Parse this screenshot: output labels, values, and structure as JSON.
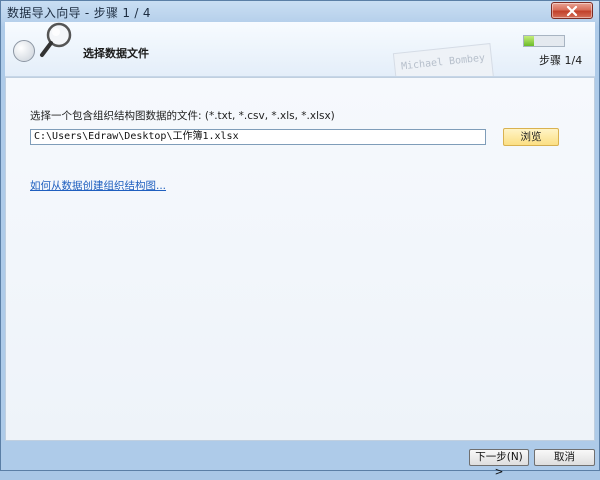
{
  "window": {
    "title": "数据导入向导 - 步骤 1 / 4",
    "close_icon": "close-icon"
  },
  "header": {
    "heading": "选择数据文件",
    "step_label": "步骤 1/4",
    "progress_fraction": 0.25,
    "background_card_text": "Michael Bombey"
  },
  "main": {
    "prompt": "选择一个包含组织结构图数据的文件: (*.txt, *.csv, *.xls, *.xlsx)",
    "file_path": "C:\\Users\\Edraw\\Desktop\\工作簿1.xlsx",
    "browse_label": "浏览",
    "help_link": "如何从数据创建组织结构图..."
  },
  "footer": {
    "next_label": "下一步(N) >",
    "cancel_label": "取消"
  },
  "colors": {
    "accent": "#1f5fbf",
    "progress": "#6cbc29",
    "close": "#c2412b"
  }
}
